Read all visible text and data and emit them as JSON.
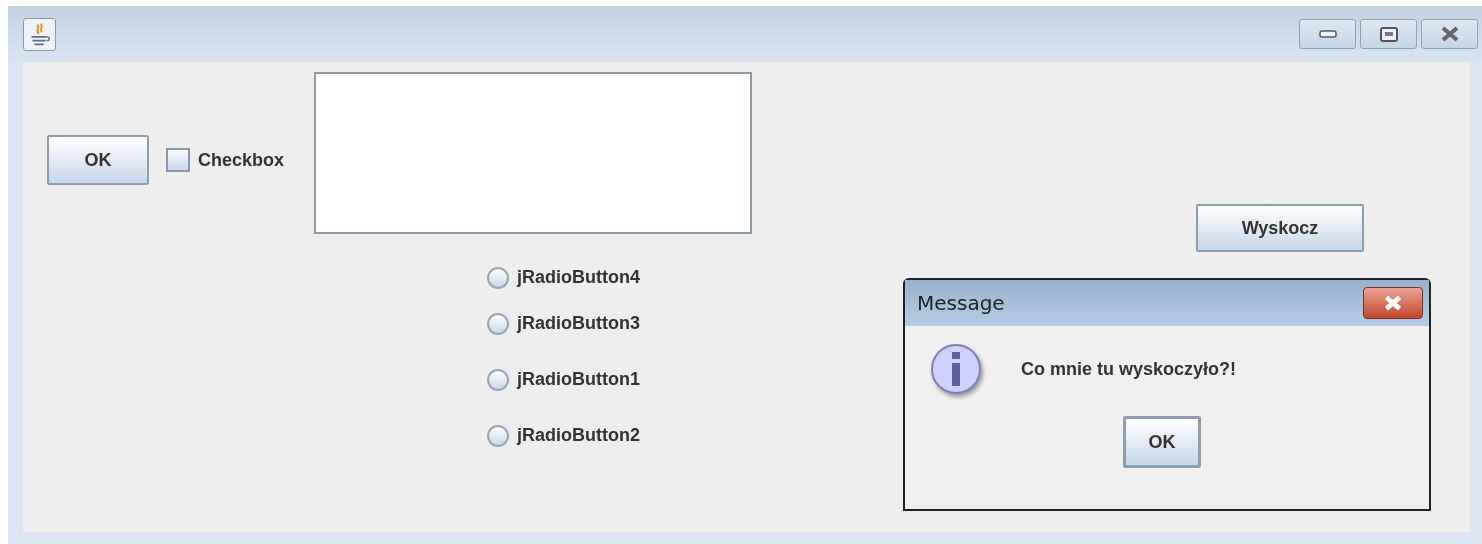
{
  "window": {
    "buttons": [
      {
        "kind": "minimize"
      },
      {
        "kind": "maximize"
      },
      {
        "kind": "close"
      }
    ]
  },
  "ok_button": {
    "label": "OK"
  },
  "checkbox": {
    "label": "Checkbox",
    "checked": false
  },
  "radio_buttons": [
    {
      "label": "jRadioButton4",
      "selected": false
    },
    {
      "label": "jRadioButton3",
      "selected": false
    },
    {
      "label": "jRadioButton1",
      "selected": false
    },
    {
      "label": "jRadioButton2",
      "selected": false
    }
  ],
  "popup_button": {
    "label": "Wyskocz"
  },
  "dialog": {
    "title": "Message",
    "message": "Co mnie tu wyskoczyło?!",
    "button": "OK"
  }
}
